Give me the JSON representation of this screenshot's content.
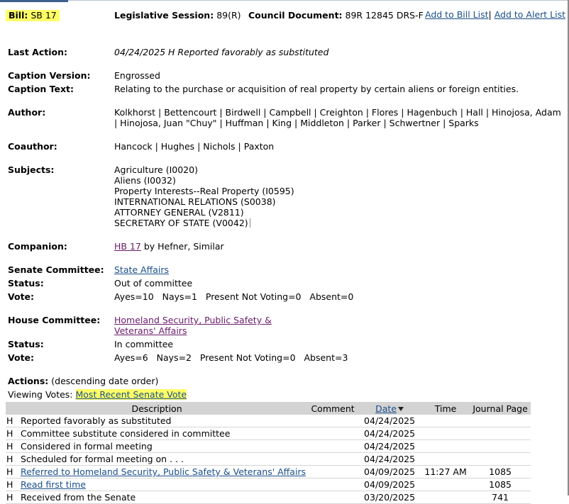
{
  "header": {
    "bill_label": "Bill:",
    "bill_number": "SB 17",
    "session_label": "Legislative Session:",
    "session_value": "89(R)",
    "council_label": "Council Document:",
    "council_value": "89R 12845 DRS-F",
    "add_bill_list": "Add to Bill List",
    "separator": "|",
    "add_alert_list": "Add to Alert List"
  },
  "details": {
    "last_action_label": "Last Action:",
    "last_action_value": "04/24/2025 H Reported favorably as substituted",
    "caption_version_label": "Caption Version:",
    "caption_version_value": "Engrossed",
    "caption_text_label": "Caption Text:",
    "caption_text_value": "Relating to the purchase or acquisition of real property by certain aliens or foreign entities.",
    "author_label": "Author:",
    "author_line1": "Kolkhorst | Bettencourt | Birdwell | Campbell | Creighton | Flores | Hagenbuch | Hall | Hinojosa, Adam",
    "author_line2": "| Hinojosa, Juan \"Chuy\" | Huffman | King | Middleton | Parker | Schwertner | Sparks",
    "coauthor_label": "Coauthor:",
    "coauthor_value": "Hancock | Hughes | Nichols | Paxton",
    "subjects_label": "Subjects:",
    "subjects": [
      "Agriculture (I0020)",
      "Aliens (I0032)",
      "Property Interests--Real Property (I0595)",
      "INTERNATIONAL RELATIONS (S0038)",
      "ATTORNEY GENERAL (V2811)",
      "SECRETARY OF STATE (V0042)"
    ],
    "companion_label": "Companion:",
    "companion_link": "HB 17",
    "companion_rest": "by Hefner, Similar",
    "senate_committee_label": "Senate Committee:",
    "senate_committee_value": "State Affairs",
    "senate_status_label": "Status:",
    "senate_status_value": "Out of committee",
    "senate_vote_label": "Vote:",
    "senate_vote_value": "Ayes=10   Nays=1   Present Not Voting=0   Absent=0",
    "house_committee_label": "House Committee:",
    "house_committee_line1": "Homeland Security, Public Safety &",
    "house_committee_line2": "Veterans' Affairs",
    "house_status_label": "Status:",
    "house_status_value": "In committee",
    "house_vote_label": "Vote:",
    "house_vote_value": "Ayes=6   Nays=2   Present Not Voting=0   Absent=3"
  },
  "actions": {
    "label": "Actions:",
    "order_note": "(descending date order)",
    "viewing_votes_label": "Viewing Votes:",
    "viewing_votes_link": "Most Recent Senate Vote",
    "columns": {
      "description": "Description",
      "comment": "Comment",
      "date": "Date",
      "time": "Time",
      "journal_page": "Journal Page"
    },
    "rows": [
      {
        "chamber": "H",
        "description": "Reported favorably as substituted",
        "link": false,
        "comment": "",
        "date": "04/24/2025",
        "time": "",
        "journal": ""
      },
      {
        "chamber": "H",
        "description": "Committee substitute considered in committee",
        "link": false,
        "comment": "",
        "date": "04/24/2025",
        "time": "",
        "journal": ""
      },
      {
        "chamber": "H",
        "description": "Considered in formal meeting",
        "link": false,
        "comment": "",
        "date": "04/24/2025",
        "time": "",
        "journal": ""
      },
      {
        "chamber": "H",
        "description": "Scheduled for formal meeting on . . .",
        "link": false,
        "comment": "",
        "date": "04/24/2025",
        "time": "",
        "journal": ""
      },
      {
        "chamber": "H",
        "description": "Referred to Homeland Security, Public Safety & Veterans' Affairs",
        "link": true,
        "comment": "",
        "date": "04/09/2025",
        "time": "11:27 AM",
        "journal": "1085"
      },
      {
        "chamber": "H",
        "description": "Read first time",
        "link": true,
        "comment": "",
        "date": "04/09/2025",
        "time": "",
        "journal": "1085"
      },
      {
        "chamber": "H",
        "description": "Received from the Senate",
        "link": false,
        "comment": "",
        "date": "03/20/2025",
        "time": "",
        "journal": "741"
      }
    ]
  }
}
